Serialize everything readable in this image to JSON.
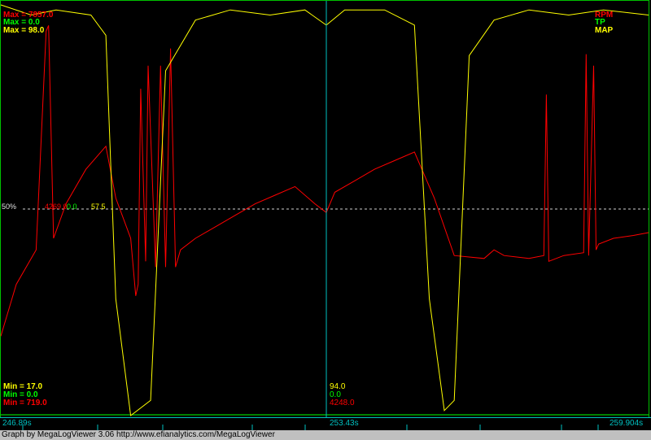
{
  "colors": {
    "rpm": "#ff0000",
    "tp": "#00ff00",
    "map": "#ffff00",
    "cursor": "#00c0c0",
    "frame": "#00c000"
  },
  "top_left": {
    "rpm_max": "Max = 7857.0",
    "tp_max": "Max = 0.0",
    "map_max": "Max = 98.0"
  },
  "top_right": {
    "rpm_name": "RPM",
    "tp_name": "TP",
    "map_name": "MAP"
  },
  "bottom_left": {
    "map_min": "Min = 17.0",
    "tp_min": "Min = 0.0",
    "rpm_min": "Min = 719.0"
  },
  "cursor_values": {
    "map": "94.0",
    "tp": "0.0",
    "rpm": "4248.0"
  },
  "midline": {
    "percent_label": "50%",
    "rpm_value": "4269.0",
    "tp_value": "0.0",
    "map_value": "57.5"
  },
  "time": {
    "start": "246.89s",
    "cursor": "253.43s",
    "end": "259.904s"
  },
  "status": {
    "text": "Graph by MegaLogViewer 3.06 http://www.efianalytics.com/MegaLogViewer"
  },
  "chart_data": {
    "type": "line",
    "x_range": [
      246.89,
      259.904
    ],
    "cursor_x": 253.43,
    "series": [
      {
        "name": "RPM",
        "range": [
          719.0,
          7857.0
        ],
        "x": [
          246.89,
          247.2,
          247.6,
          247.8,
          247.85,
          247.95,
          248.2,
          248.6,
          249.0,
          249.2,
          249.5,
          249.6,
          249.65,
          249.7,
          249.8,
          249.85,
          250.0,
          250.1,
          250.2,
          250.3,
          250.4,
          250.5,
          250.8,
          251.2,
          251.6,
          252.0,
          252.4,
          252.8,
          253.2,
          253.43,
          253.6,
          254.0,
          254.4,
          254.8,
          255.2,
          255.6,
          256.0,
          256.6,
          256.8,
          257.0,
          257.5,
          257.8,
          257.85,
          257.9,
          258.2,
          258.6,
          258.65,
          258.7,
          258.8,
          258.85,
          258.9,
          259.2,
          259.6,
          259.904
        ],
        "values": [
          2100,
          3000,
          3600,
          7400,
          7500,
          3800,
          4400,
          5000,
          5400,
          4500,
          3800,
          2800,
          3000,
          6400,
          3400,
          6800,
          3300,
          6800,
          3300,
          7100,
          3300,
          3600,
          3800,
          4000,
          4200,
          4400,
          4550,
          4700,
          4400,
          4248,
          4600,
          4800,
          5000,
          5150,
          5300,
          4500,
          3500,
          3450,
          3600,
          3500,
          3450,
          3500,
          6300,
          3400,
          3500,
          3550,
          7000,
          3500,
          6800,
          3600,
          3700,
          3800,
          3850,
          3900
        ]
      },
      {
        "name": "TP",
        "range": [
          0.0,
          0.0
        ],
        "x": [
          246.89,
          259.904
        ],
        "values": [
          0.0,
          0.0
        ]
      },
      {
        "name": "MAP",
        "range": [
          17.0,
          98.0
        ],
        "x": [
          246.89,
          247.5,
          248.0,
          248.7,
          249.0,
          249.2,
          249.5,
          249.9,
          250.2,
          250.8,
          251.5,
          252.3,
          253.0,
          253.43,
          253.8,
          254.6,
          255.2,
          255.5,
          255.8,
          256.0,
          256.3,
          256.8,
          257.5,
          258.3,
          259.0,
          259.904
        ],
        "values": [
          98,
          96,
          97,
          96,
          92,
          40,
          17,
          20,
          85,
          95,
          97,
          96,
          97,
          94,
          97,
          97,
          94,
          40,
          18,
          20,
          88,
          95,
          97,
          96,
          97,
          96
        ]
      }
    ]
  }
}
